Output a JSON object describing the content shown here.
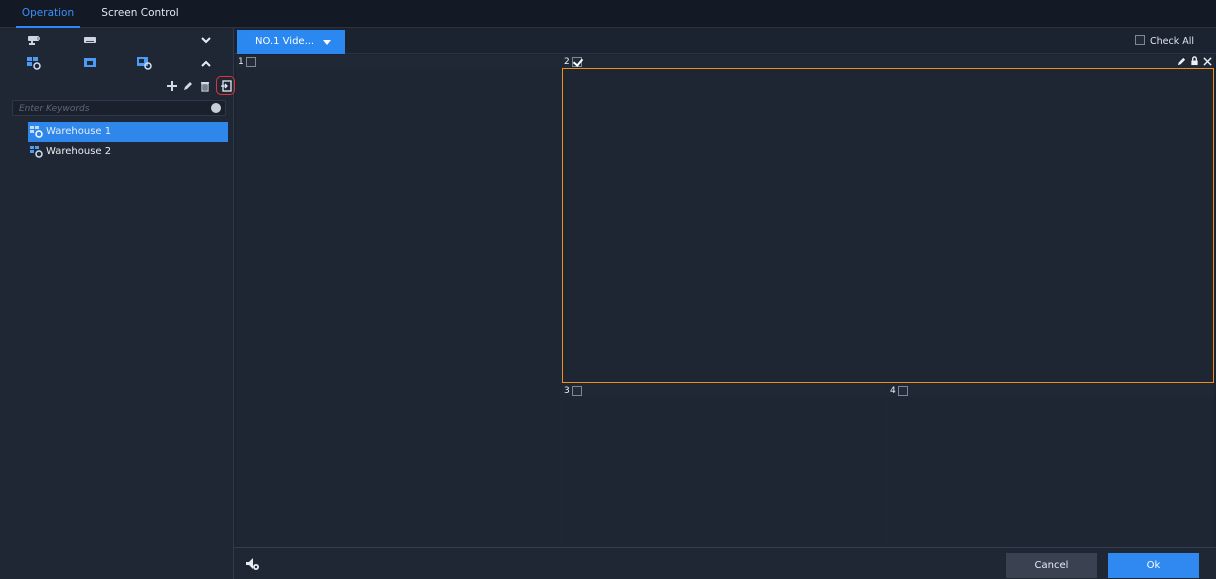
{
  "top_nav": {
    "tabs": [
      {
        "label": "Operation",
        "active": true
      },
      {
        "label": "Screen Control",
        "active": false
      }
    ]
  },
  "sidebar": {
    "icon_rows": [
      {
        "icons": [
          "camera-icon",
          "nvr-device-icon"
        ],
        "toggle": "chevron-down-icon"
      },
      {
        "icons": [
          "view-plan-icon",
          "screen-icon",
          "tour-plan-icon"
        ],
        "toggle": "chevron-up-icon"
      }
    ],
    "actions": [
      "add-icon",
      "edit-icon",
      "delete-icon",
      "import-icon"
    ],
    "search": {
      "placeholder": "Enter Keywords",
      "value": ""
    },
    "tree": [
      {
        "label": "Warehouse 1",
        "selected": true
      },
      {
        "label": "Warehouse 2",
        "selected": false
      }
    ]
  },
  "main": {
    "layout_tab": {
      "label": "NO.1 Vide..."
    },
    "check_all": {
      "label": "Check All",
      "checked": false
    },
    "panes": [
      {
        "number": "1",
        "checked": false,
        "selected": false
      },
      {
        "number": "2",
        "checked": true,
        "selected": true
      },
      {
        "number": "3",
        "checked": false,
        "selected": false
      },
      {
        "number": "4",
        "checked": false,
        "selected": false
      }
    ]
  },
  "bottom": {
    "cancel_label": "Cancel",
    "ok_label": "Ok"
  },
  "colors": {
    "accent": "#2f89f0",
    "selection_border": "#f08f1e",
    "highlight_ring": "#e0343a",
    "background": "#1b2330"
  }
}
